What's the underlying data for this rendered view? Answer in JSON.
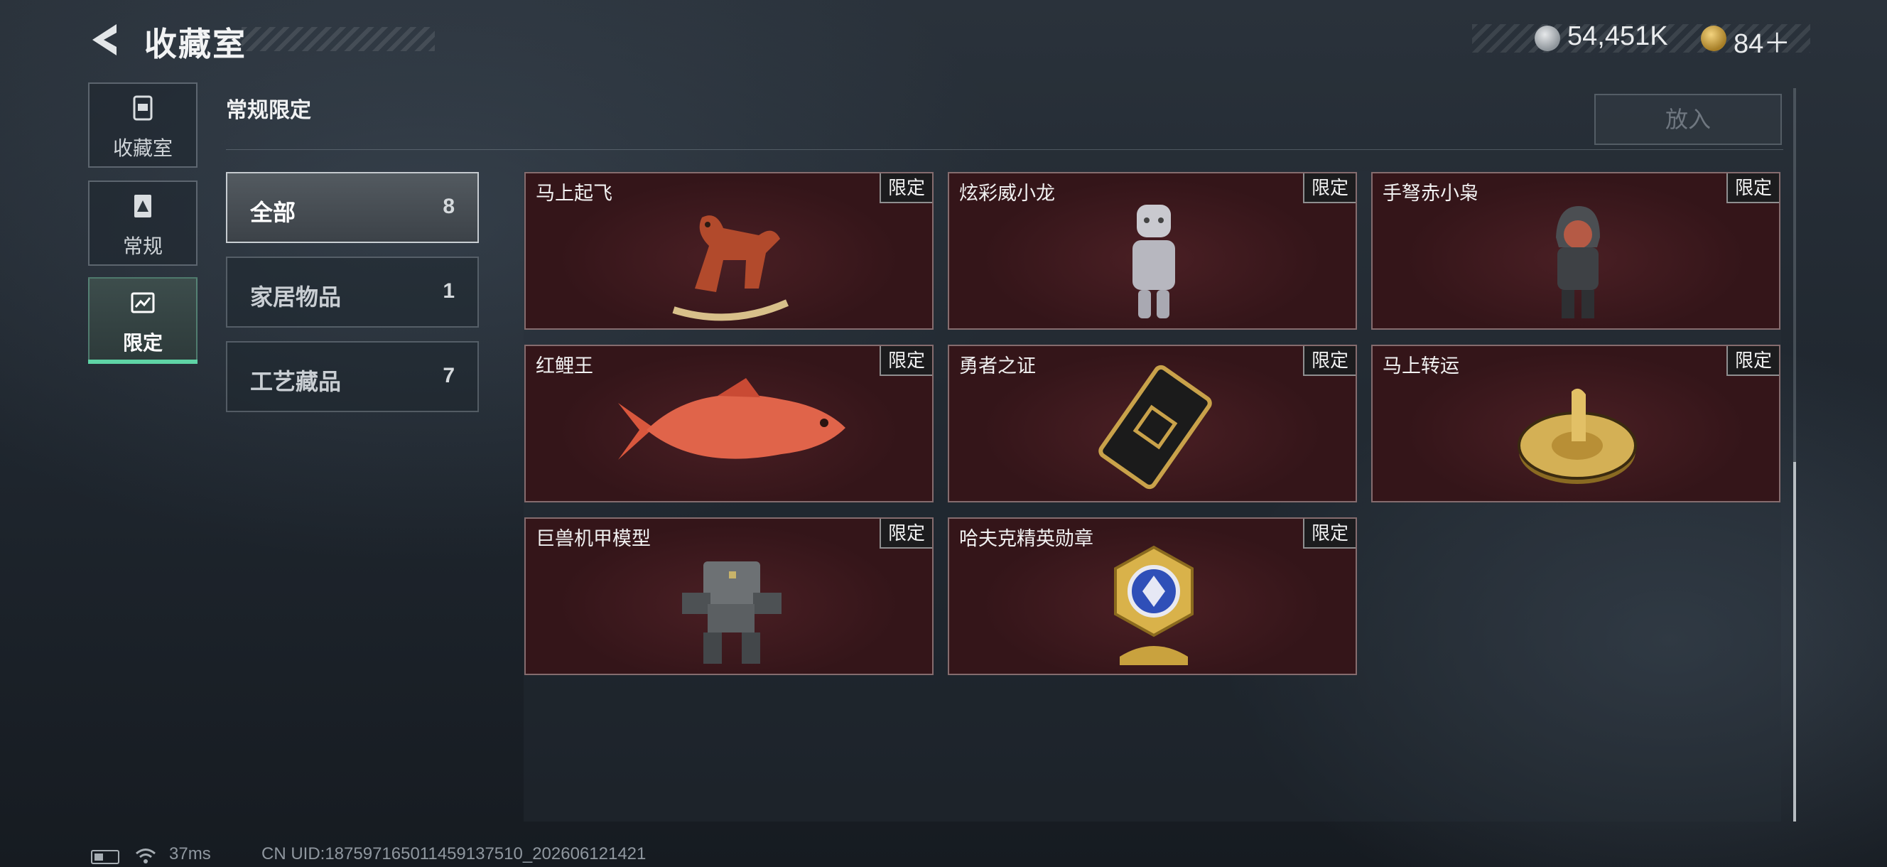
{
  "header": {
    "title": "收藏室",
    "currency": [
      {
        "icon": "silver-coin-icon",
        "value": "54,451K"
      },
      {
        "icon": "gold-coin-icon",
        "value": "84＋"
      }
    ]
  },
  "sidebar": {
    "items": [
      {
        "label": "收藏室",
        "icon": "collection-room-icon",
        "active": false
      },
      {
        "label": "常规",
        "icon": "regular-icon",
        "active": false
      },
      {
        "label": "限定",
        "icon": "limited-icon",
        "active": true
      }
    ]
  },
  "section": {
    "title": "常规限定",
    "put_label": "放入"
  },
  "categories": [
    {
      "label": "全部",
      "count": "8",
      "active": true
    },
    {
      "label": "家居物品",
      "count": "1",
      "active": false
    },
    {
      "label": "工艺藏品",
      "count": "7",
      "active": false
    }
  ],
  "items": [
    {
      "name": "马上起飞",
      "tag": "限定",
      "icon": "rocking-horse-icon"
    },
    {
      "name": "炫彩威小龙",
      "tag": "限定",
      "icon": "dragon-figurine-icon"
    },
    {
      "name": "手弩赤小枭",
      "tag": "限定",
      "icon": "hooded-figurine-icon"
    },
    {
      "name": "红鲤王",
      "tag": "限定",
      "icon": "red-carp-icon"
    },
    {
      "name": "勇者之证",
      "tag": "限定",
      "icon": "card-icon"
    },
    {
      "name": "马上转运",
      "tag": "限定",
      "icon": "golden-wheel-icon"
    },
    {
      "name": "巨兽机甲模型",
      "tag": "限定",
      "icon": "mech-model-icon"
    },
    {
      "name": "哈夫克精英勋章",
      "tag": "限定",
      "icon": "medal-icon"
    }
  ],
  "footer": {
    "ping": "37ms",
    "uid": "CN UID:18759716501145913751​0_202606121421"
  },
  "colors": {
    "accent": "#5fd4a6",
    "card_bg": "#3a171b"
  }
}
